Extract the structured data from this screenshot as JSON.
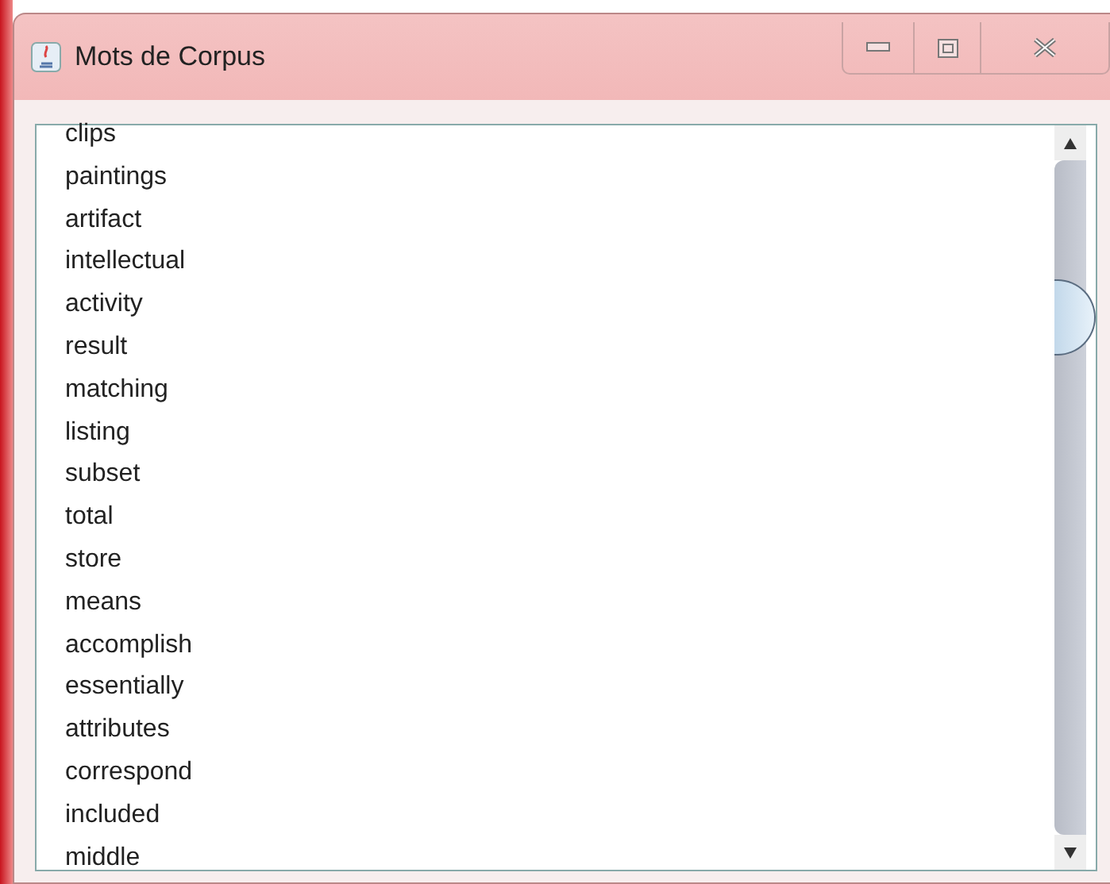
{
  "window": {
    "title": "Mots de Corpus"
  },
  "list": {
    "items": [
      "clips",
      "paintings",
      "artifact",
      "intellectual",
      "activity",
      "result",
      "matching",
      "listing",
      "subset",
      "total",
      "store",
      "means",
      "accomplish",
      "essentially",
      "attributes",
      "correspond",
      "included",
      "middle"
    ]
  }
}
